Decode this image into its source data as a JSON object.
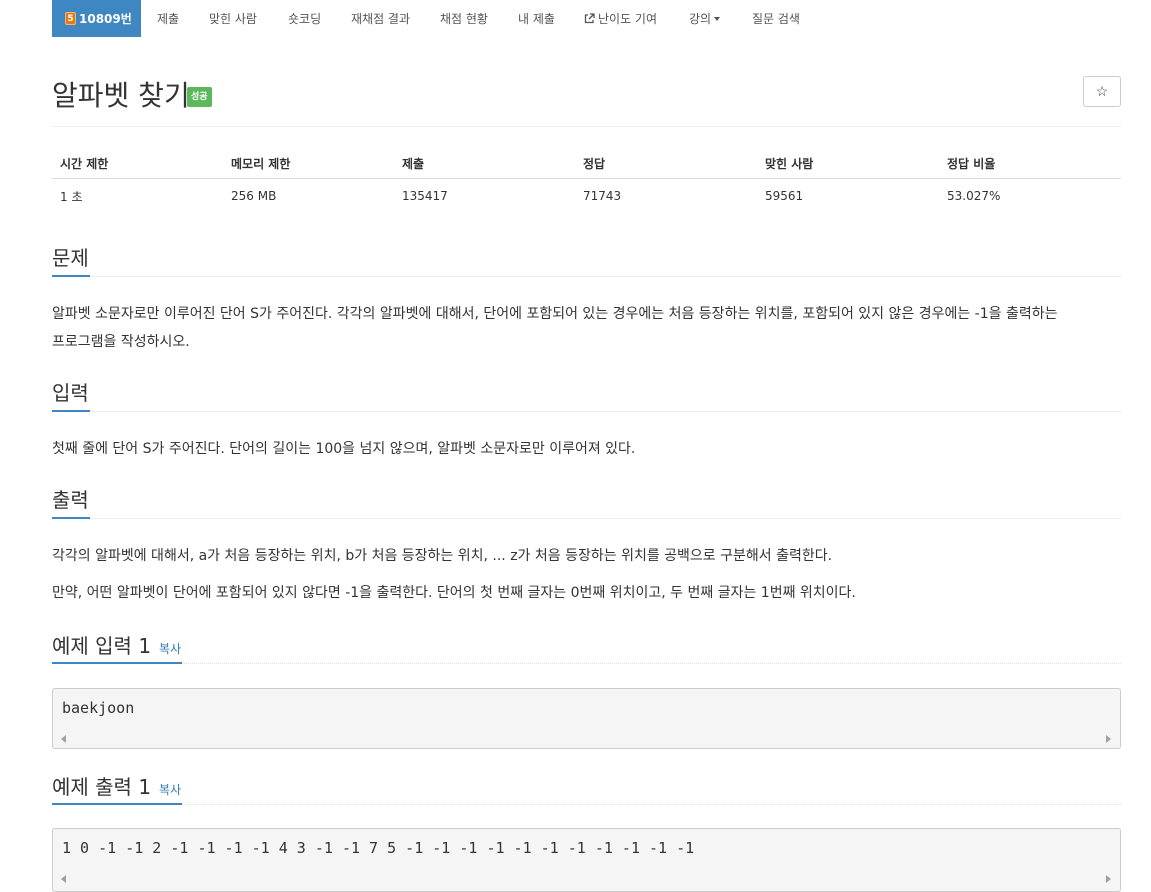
{
  "nav": {
    "active_badge": "5",
    "active_label": "10809번",
    "items": [
      "제출",
      "맞힌 사람",
      "숏코딩",
      "재채점 결과",
      "채점 현황",
      "내 제출",
      "난이도 기여",
      "강의",
      "질문 검색"
    ]
  },
  "problem": {
    "title": "알파벳 찾기",
    "status_badge": "성공",
    "star_glyph": "☆"
  },
  "info": {
    "headers": [
      "시간 제한",
      "메모리 제한",
      "제출",
      "정답",
      "맞힌 사람",
      "정답 비율"
    ],
    "values": [
      "1 초",
      "256 MB",
      "135417",
      "71743",
      "59561",
      "53.027%"
    ]
  },
  "sections": {
    "description_title": "문제",
    "description_line1": "알파벳 소문자로만 이루어진 단어 S가 주어진다. 각각의 알파벳에 대해서, 단어에 포함되어 있는 경우에는 처음 등장하는 위치를, 포함되어 있지 않은 경우에는 -1을 출력하는",
    "description_line2": "프로그램을 작성하시오.",
    "input_title": "입력",
    "input_text": "첫째 줄에 단어 S가 주어진다. 단어의 길이는 100을 넘지 않으며, 알파벳 소문자로만 이루어져 있다.",
    "output_title": "출력",
    "output_text1": "각각의 알파벳에 대해서, a가 처음 등장하는 위치, b가 처음 등장하는 위치, ... z가 처음 등장하는 위치를 공백으로 구분해서 출력한다.",
    "output_text2": "만약, 어떤 알파벳이 단어에 포함되어 있지 않다면 -1을 출력한다. 단어의 첫 번째 글자는 0번째 위치이고, 두 번째 글자는 1번째 위치이다.",
    "sample_input_title": "예제 입력 1",
    "sample_output_title": "예제 출력 1",
    "copy_label": "복사"
  },
  "samples": {
    "input": "baekjoon",
    "output": "1 0 -1 -1 2 -1 -1 -1 -1 4 3 -1 -1 7 5 -1 -1 -1 -1 -1 -1 -1 -1 -1 -1 -1"
  },
  "colors": {
    "nav_active": "#3f87c2",
    "success_badge": "#5cb85c",
    "tier_badge": "#e37b1a",
    "link": "#337ab7"
  }
}
